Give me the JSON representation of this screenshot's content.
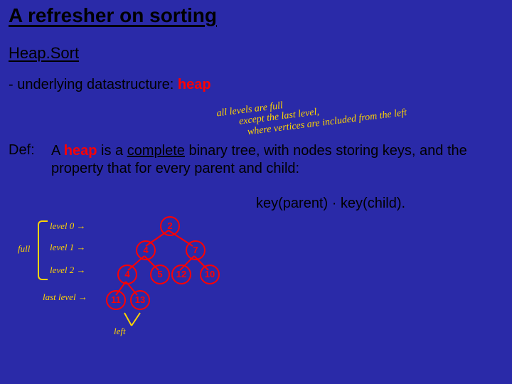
{
  "slide": {
    "title": "A refresher on sorting",
    "subtitle": "Heap.Sort",
    "line1_prefix": "- underlying datastructure:  ",
    "line1_heap": "heap",
    "def_label": "Def:",
    "def_body_1": "A ",
    "def_body_heap": "heap",
    "def_body_2": " is a ",
    "def_body_complete": "complete",
    "def_body_3": " binary tree, with nodes storing keys, and the property that for every parent and child:",
    "key_inequality": "key(parent) · key(child).",
    "annotation": {
      "line1": "all levels are full",
      "line2": "except the last level,",
      "line3": "where vertices are included from the left"
    },
    "levels": {
      "full": "full",
      "l0": "level 0  →",
      "l1": "level 1  →",
      "l2": "level 2  →",
      "last": "last level →",
      "left": "left"
    },
    "tree": {
      "n1": "2",
      "n2": "4",
      "n3": "7",
      "n4": "4",
      "n5": "5",
      "n6": "12",
      "n7": "10",
      "n8": "11",
      "n9": "13"
    }
  }
}
